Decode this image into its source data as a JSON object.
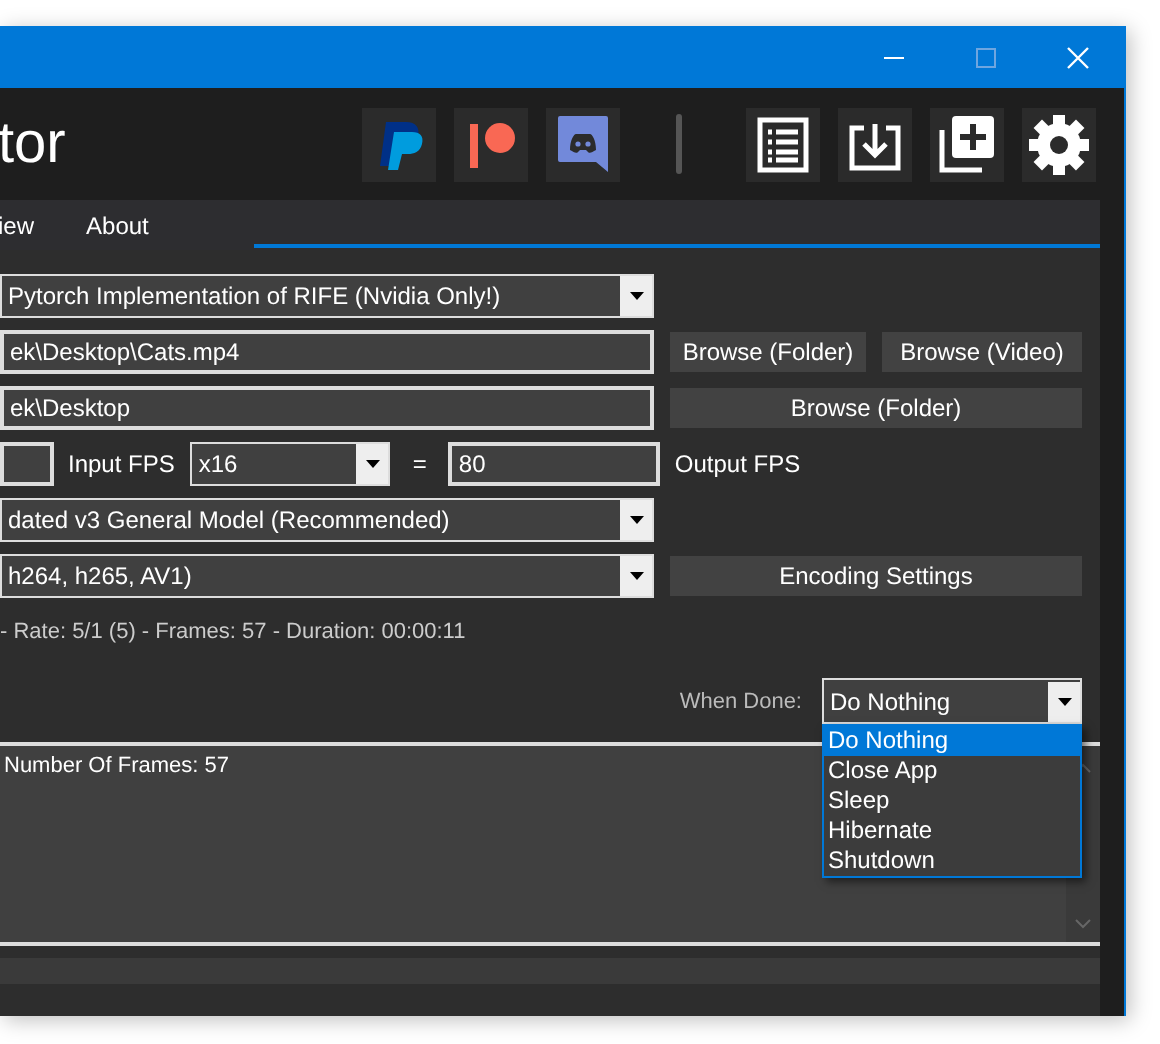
{
  "header": {
    "app_title": "tor"
  },
  "tabs": [
    {
      "label": "iew",
      "selected": false
    },
    {
      "label": "About",
      "selected": false
    }
  ],
  "ai_combo": {
    "value": "Pytorch Implementation of RIFE (Nvidia Only!)"
  },
  "input_path": {
    "value": "ek\\Desktop\\Cats.mp4",
    "buttons": [
      "Browse (Folder)",
      "Browse (Video)"
    ]
  },
  "output_path": {
    "value": "ek\\Desktop",
    "button": "Browse (Folder)"
  },
  "fps": {
    "input_label": "Input FPS",
    "factor": "x16",
    "equals": "=",
    "output_value": "80",
    "output_label": "Output FPS"
  },
  "model_combo": {
    "value": "dated v3 General Model (Recommended)"
  },
  "encoder_combo": {
    "value": "h264, h265, AV1)",
    "button": "Encoding Settings"
  },
  "info": "- Rate: 5/1 (5) - Frames: 57 - Duration: 00:00:11",
  "when_done": {
    "label": "When Done:",
    "value": "Do Nothing",
    "expanded": true,
    "options": [
      {
        "label": "Do Nothing",
        "selected": true
      },
      {
        "label": "Close App",
        "selected": false
      },
      {
        "label": "Sleep",
        "selected": false
      },
      {
        "label": "Hibernate",
        "selected": false
      },
      {
        "label": "Shutdown",
        "selected": false
      }
    ]
  },
  "log": "Number Of Frames: 57",
  "progress": {
    "level": 0
  }
}
